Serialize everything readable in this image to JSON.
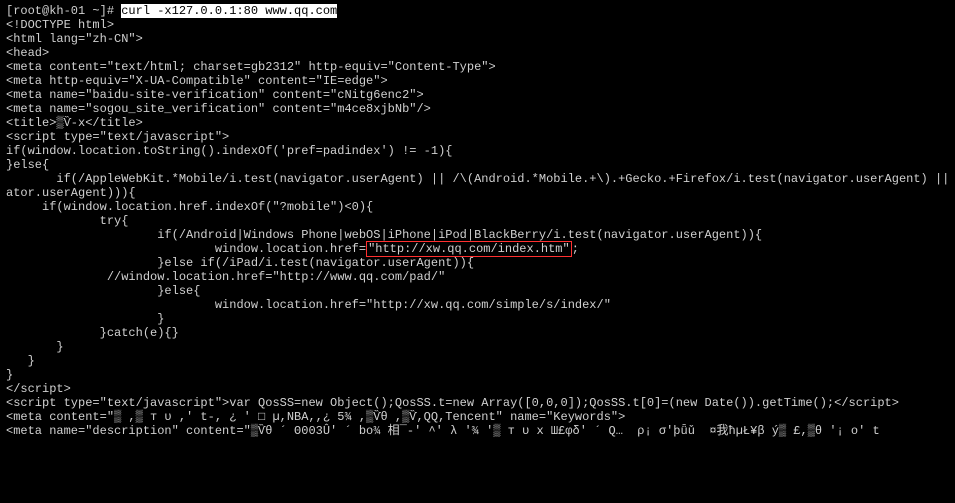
{
  "prompt": "[root@kh-01 ~]# ",
  "command": "curl -x127.0.0.1:80 www.qq.com",
  "lines": [
    "<!DOCTYPE html>",
    "<html lang=\"zh-CN\">",
    "<head>",
    "<meta content=\"text/html; charset=gb2312\" http-equiv=\"Content-Type\">",
    "<meta http-equiv=\"X-UA-Compatible\" content=\"IE=edge\">",
    "<meta name=\"baidu-site-verification\" content=\"cNitg6enc2\">",
    "<meta name=\"sogou_site_verification\" content=\"m4ce8xjbNb\"/>",
    "<title>▒Ѷ-x</title>",
    "<script type=\"text/javascript\">",
    "if(window.location.toString().indexOf('pref=padindex') != -1){",
    "}else{",
    "       if(/AppleWebKit.*Mobile/i.test(navigator.userAgent) || /\\(Android.*Mobile.+\\).+Gecko.+Firefox/i.test(navigator.userAgent) || (/",
    "ator.userAgent))){",
    "     if(window.location.href.indexOf(\"?mobile\")<0){",
    "             try{",
    "                     if(/Android|Windows Phone|webOS|iPhone|iPod|BlackBerry/i.test(navigator.userAgent)){"
  ],
  "hl_prefix": "                             window.location.href=",
  "hl_text": "\"http://xw.qq.com/index.htm\"",
  "hl_suffix": ";",
  "lines2": [
    "                     }else if(/iPad/i.test(navigator.userAgent)){",
    "              //window.location.href=\"http://www.qq.com/pad/\"",
    "                     }else{",
    "                             window.location.href=\"http://xw.qq.com/simple/s/index/\"",
    "                     }",
    "             }catch(e){}",
    "       }",
    "   }",
    "}",
    "</script>",
    "<script type=\"text/javascript\">var QosSS=new Object();QosSS.t=new Array([0,0,0]);QosSS.t[0]=(new Date()).getTime();</script>",
    "<meta content=\"▒ ,▒ т υ ,' t-, ¿ ' □ µ,NBA,,¿ 5¾ ,▒Ѷθ ,▒Ѷ,QQ,Tencent\" name=\"Keywords\">",
    "<meta name=\"description\" content=\"▒Ѷθ ´ Θ003Û' ´ bo¾ 相¯-' ^' λ '¾ '▒ т υ х Ш£φδ' ´ Q…  ρ¡ σ'þǖǔ  ¤我ħµŁ¥β ý▒ £,▒θ '¡ o' t"
  ]
}
